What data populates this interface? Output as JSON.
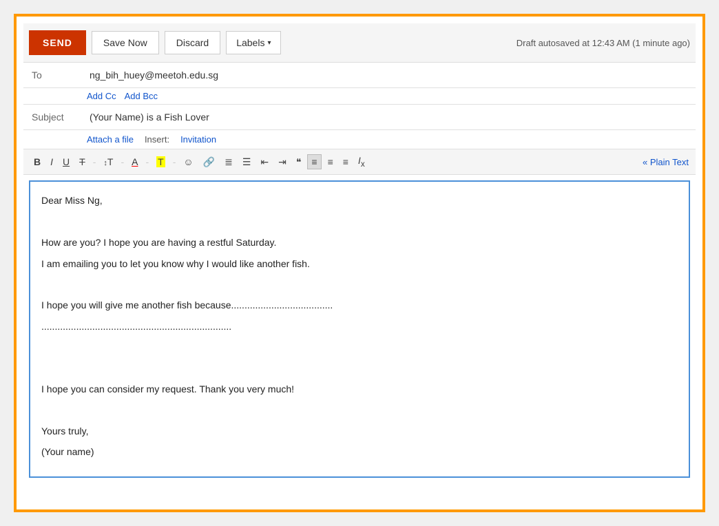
{
  "toolbar": {
    "send_label": "SEND",
    "save_now_label": "Save Now",
    "discard_label": "Discard",
    "labels_label": "Labels",
    "draft_status": "Draft autosaved at 12:43 AM (1 minute ago)"
  },
  "compose": {
    "to_label": "To",
    "to_value": "ng_bih_huey@meetoh.edu.sg",
    "add_cc": "Add Cc",
    "add_bcc": "Add Bcc",
    "subject_label": "Subject",
    "subject_value": "(Your Name) is a Fish Lover",
    "attach_label": "Attach a file",
    "insert_label": "Insert:",
    "invitation_label": "Invitation"
  },
  "formatting": {
    "bold": "B",
    "italic": "I",
    "underline": "U",
    "strikethrough": "T",
    "size_label": "T",
    "font_color": "A",
    "bgcolor": "T",
    "emoji": "☺",
    "link": "∞",
    "num_list": "≡",
    "bul_list": "≡",
    "indent_less": "⇐",
    "indent_more": "⇒",
    "blockquote": "❝",
    "align_left": "≡",
    "align_center": "≡",
    "align_right": "≡",
    "remove_format": "Ix",
    "plain_text": "« Plain Text"
  },
  "body": {
    "line1": "Dear Miss Ng,",
    "line2": "",
    "line3": "How are you? I hope you are having a restful Saturday.",
    "line4": "I am emailing you to let you know why I would like another fish.",
    "line5": "",
    "line6": "I hope you will give me another fish because......................................",
    "line7": ".......................................................................",
    "line8": "",
    "line9": "",
    "line10": "I hope you can consider my request. Thank you very much!",
    "line11": "",
    "line12": "Yours truly,",
    "line13": "(Your name)"
  }
}
